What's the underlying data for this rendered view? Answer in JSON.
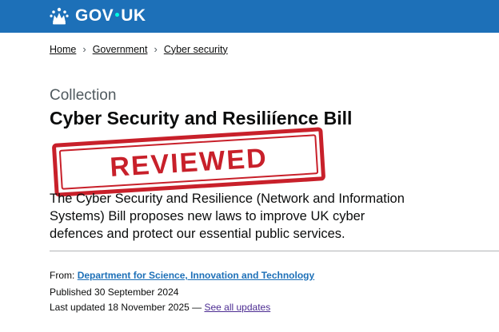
{
  "header": {
    "logo_text_left": "GOV",
    "logo_text_right": "UK",
    "brand_color": "#1d70b8",
    "logo_icon": "crown-icon"
  },
  "breadcrumb": {
    "items": [
      {
        "label": "Home"
      },
      {
        "label": "Government"
      },
      {
        "label": "Cyber security"
      }
    ],
    "separator_icon": "chevron-right-icon"
  },
  "main": {
    "caption": "Collection",
    "title": "Cyber Security and Resiliíence Bill",
    "stamp_text": "REVIEWED",
    "stamp_color": "#c8202a",
    "description": "The Cyber Security and Resilience (Network and Information Systems) Bill proposes new laws to improve UK cyber defences and protect our essential public services."
  },
  "metadata": {
    "from_label": "From:",
    "from_link": "Department for Science, Innovation and Technology",
    "published": "Published 30 September 2024",
    "last_updated": "Last updated 18 November 2025 — ",
    "see_all_updates": "See all updates"
  }
}
